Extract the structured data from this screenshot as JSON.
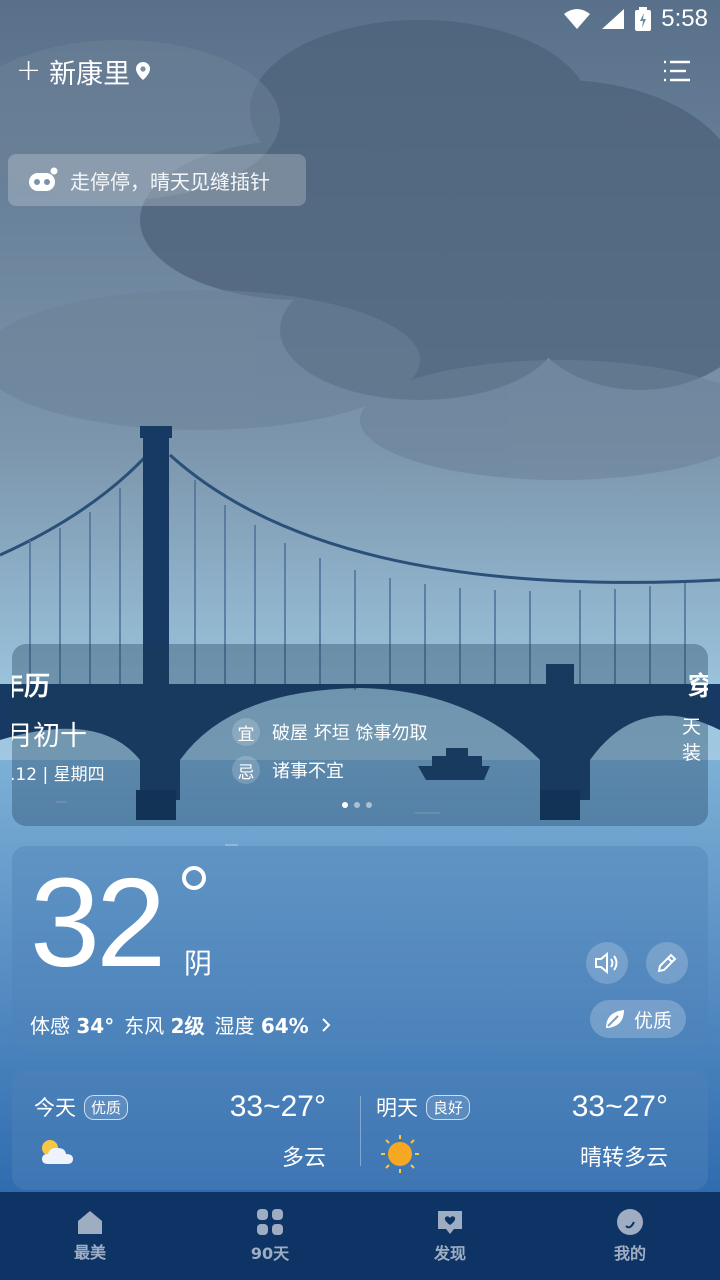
{
  "status_bar": {
    "time": "5:58"
  },
  "header": {
    "city": "新康里"
  },
  "notice": {
    "text": "走停停，晴天见缝插针"
  },
  "almanac": {
    "title": "年历",
    "lunar_date": "月初十",
    "solar_date": ".12 | 星期四",
    "good_label": "宜",
    "good_items": "破屋 坏垣 馀事勿取",
    "bad_label": "忌",
    "bad_items": "诸事不宜",
    "next_card_title": "穿",
    "next_card_text": "天 装"
  },
  "current": {
    "temperature": "32",
    "condition": "阴",
    "feels_label": "体感",
    "feels_value": "34°",
    "wind_dir": "东风",
    "wind_level": "2级",
    "humidity_label": "湿度",
    "humidity_value": "64%",
    "aqi": "优质"
  },
  "forecast": [
    {
      "day": "今天",
      "aqi": "优质",
      "range": "33~27°",
      "condition": "多云",
      "icon": "partly-cloudy-icon"
    },
    {
      "day": "明天",
      "aqi": "良好",
      "range": "33~27°",
      "condition": "晴转多云",
      "icon": "sun-icon"
    }
  ],
  "nav": [
    {
      "label": "最美",
      "icon": "home-icon"
    },
    {
      "label": "90天",
      "icon": "grid-icon"
    },
    {
      "label": "发现",
      "icon": "discover-icon"
    },
    {
      "label": "我的",
      "icon": "profile-icon"
    }
  ],
  "colors": {
    "nav_bg": "#0e3466",
    "bridge": "#163a63",
    "sky": "#9cc6df"
  }
}
